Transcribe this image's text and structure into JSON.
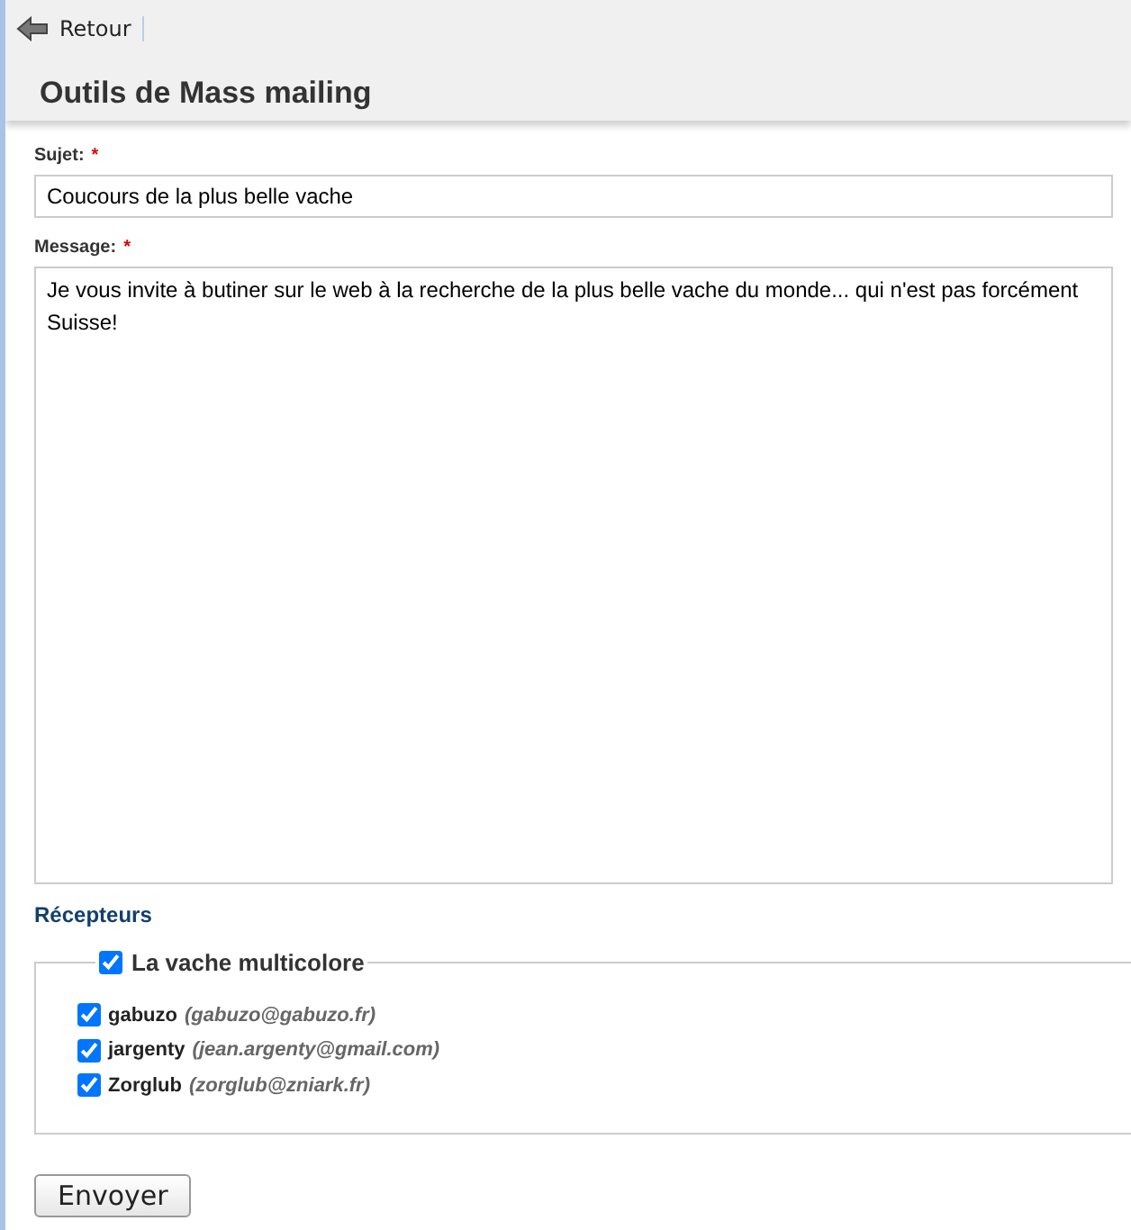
{
  "toolbar": {
    "back_label": "Retour"
  },
  "page_title": "Outils de Mass mailing",
  "form": {
    "subject": {
      "label": "Sujet:",
      "required_mark": "*",
      "value": "Coucours de la plus belle vache"
    },
    "message": {
      "label": "Message:",
      "required_mark": "*",
      "value": "Je vous invite à butiner sur le web à la recherche de la plus belle vache du monde... qui n'est pas forcément Suisse!"
    }
  },
  "recipients": {
    "heading": "Récepteurs",
    "groups": [
      {
        "name": "La vache multicolore",
        "checked": true,
        "members": [
          {
            "name": "gabuzo",
            "email": "(gabuzo@gabuzo.fr)",
            "checked": true
          },
          {
            "name": "jargenty",
            "email": "(jean.argenty@gmail.com)",
            "checked": true
          },
          {
            "name": "Zorglub",
            "email": "(zorglub@zniark.fr)",
            "checked": true
          }
        ]
      }
    ]
  },
  "submit_label": "Envoyer"
}
